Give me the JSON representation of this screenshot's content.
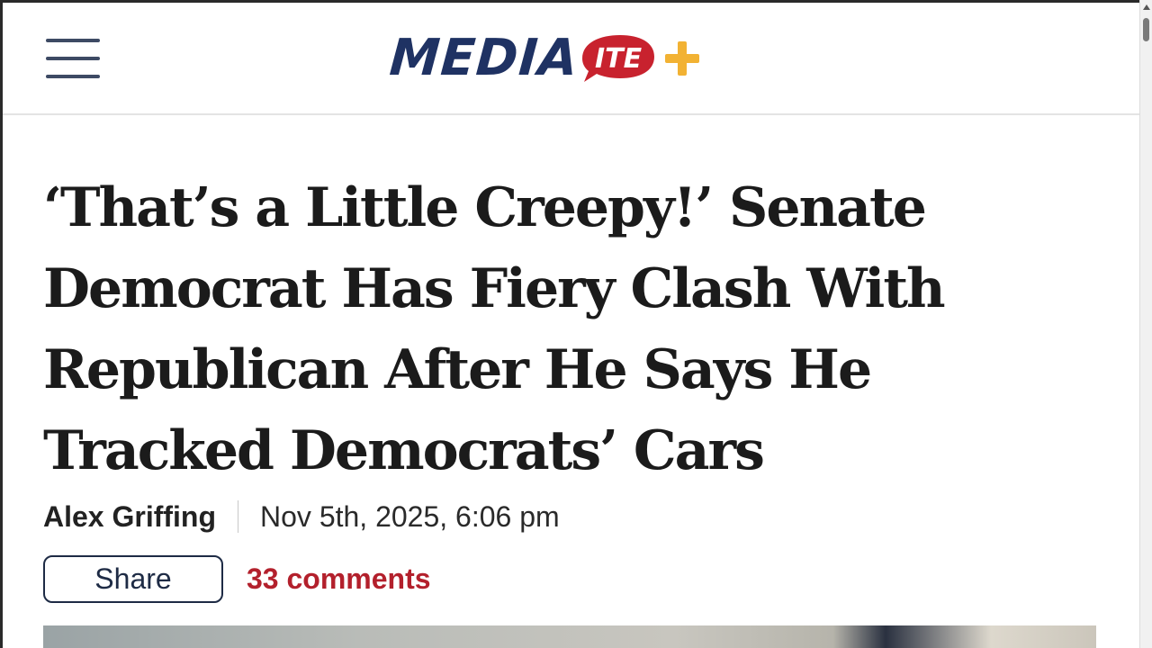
{
  "header": {
    "logo_text": "MEDIA",
    "logo_bubble_text": "ITE",
    "logo_plus": "+",
    "menu_icon": "hamburger-menu-icon"
  },
  "article": {
    "headline": "‘That’s a Little Creepy!’ Senate Democrat Has Fiery Clash With Republican After He Says He Tracked Democrats’ Cars",
    "author": "Alex Griffing",
    "date": "Nov 5th, 2025, 6:06 pm",
    "share_label": "Share",
    "comments_label": "33 comments"
  },
  "colors": {
    "brand_navy": "#1f3263",
    "brand_red": "#c8222e",
    "brand_gold": "#f2b233",
    "comments_red": "#b3202c"
  }
}
